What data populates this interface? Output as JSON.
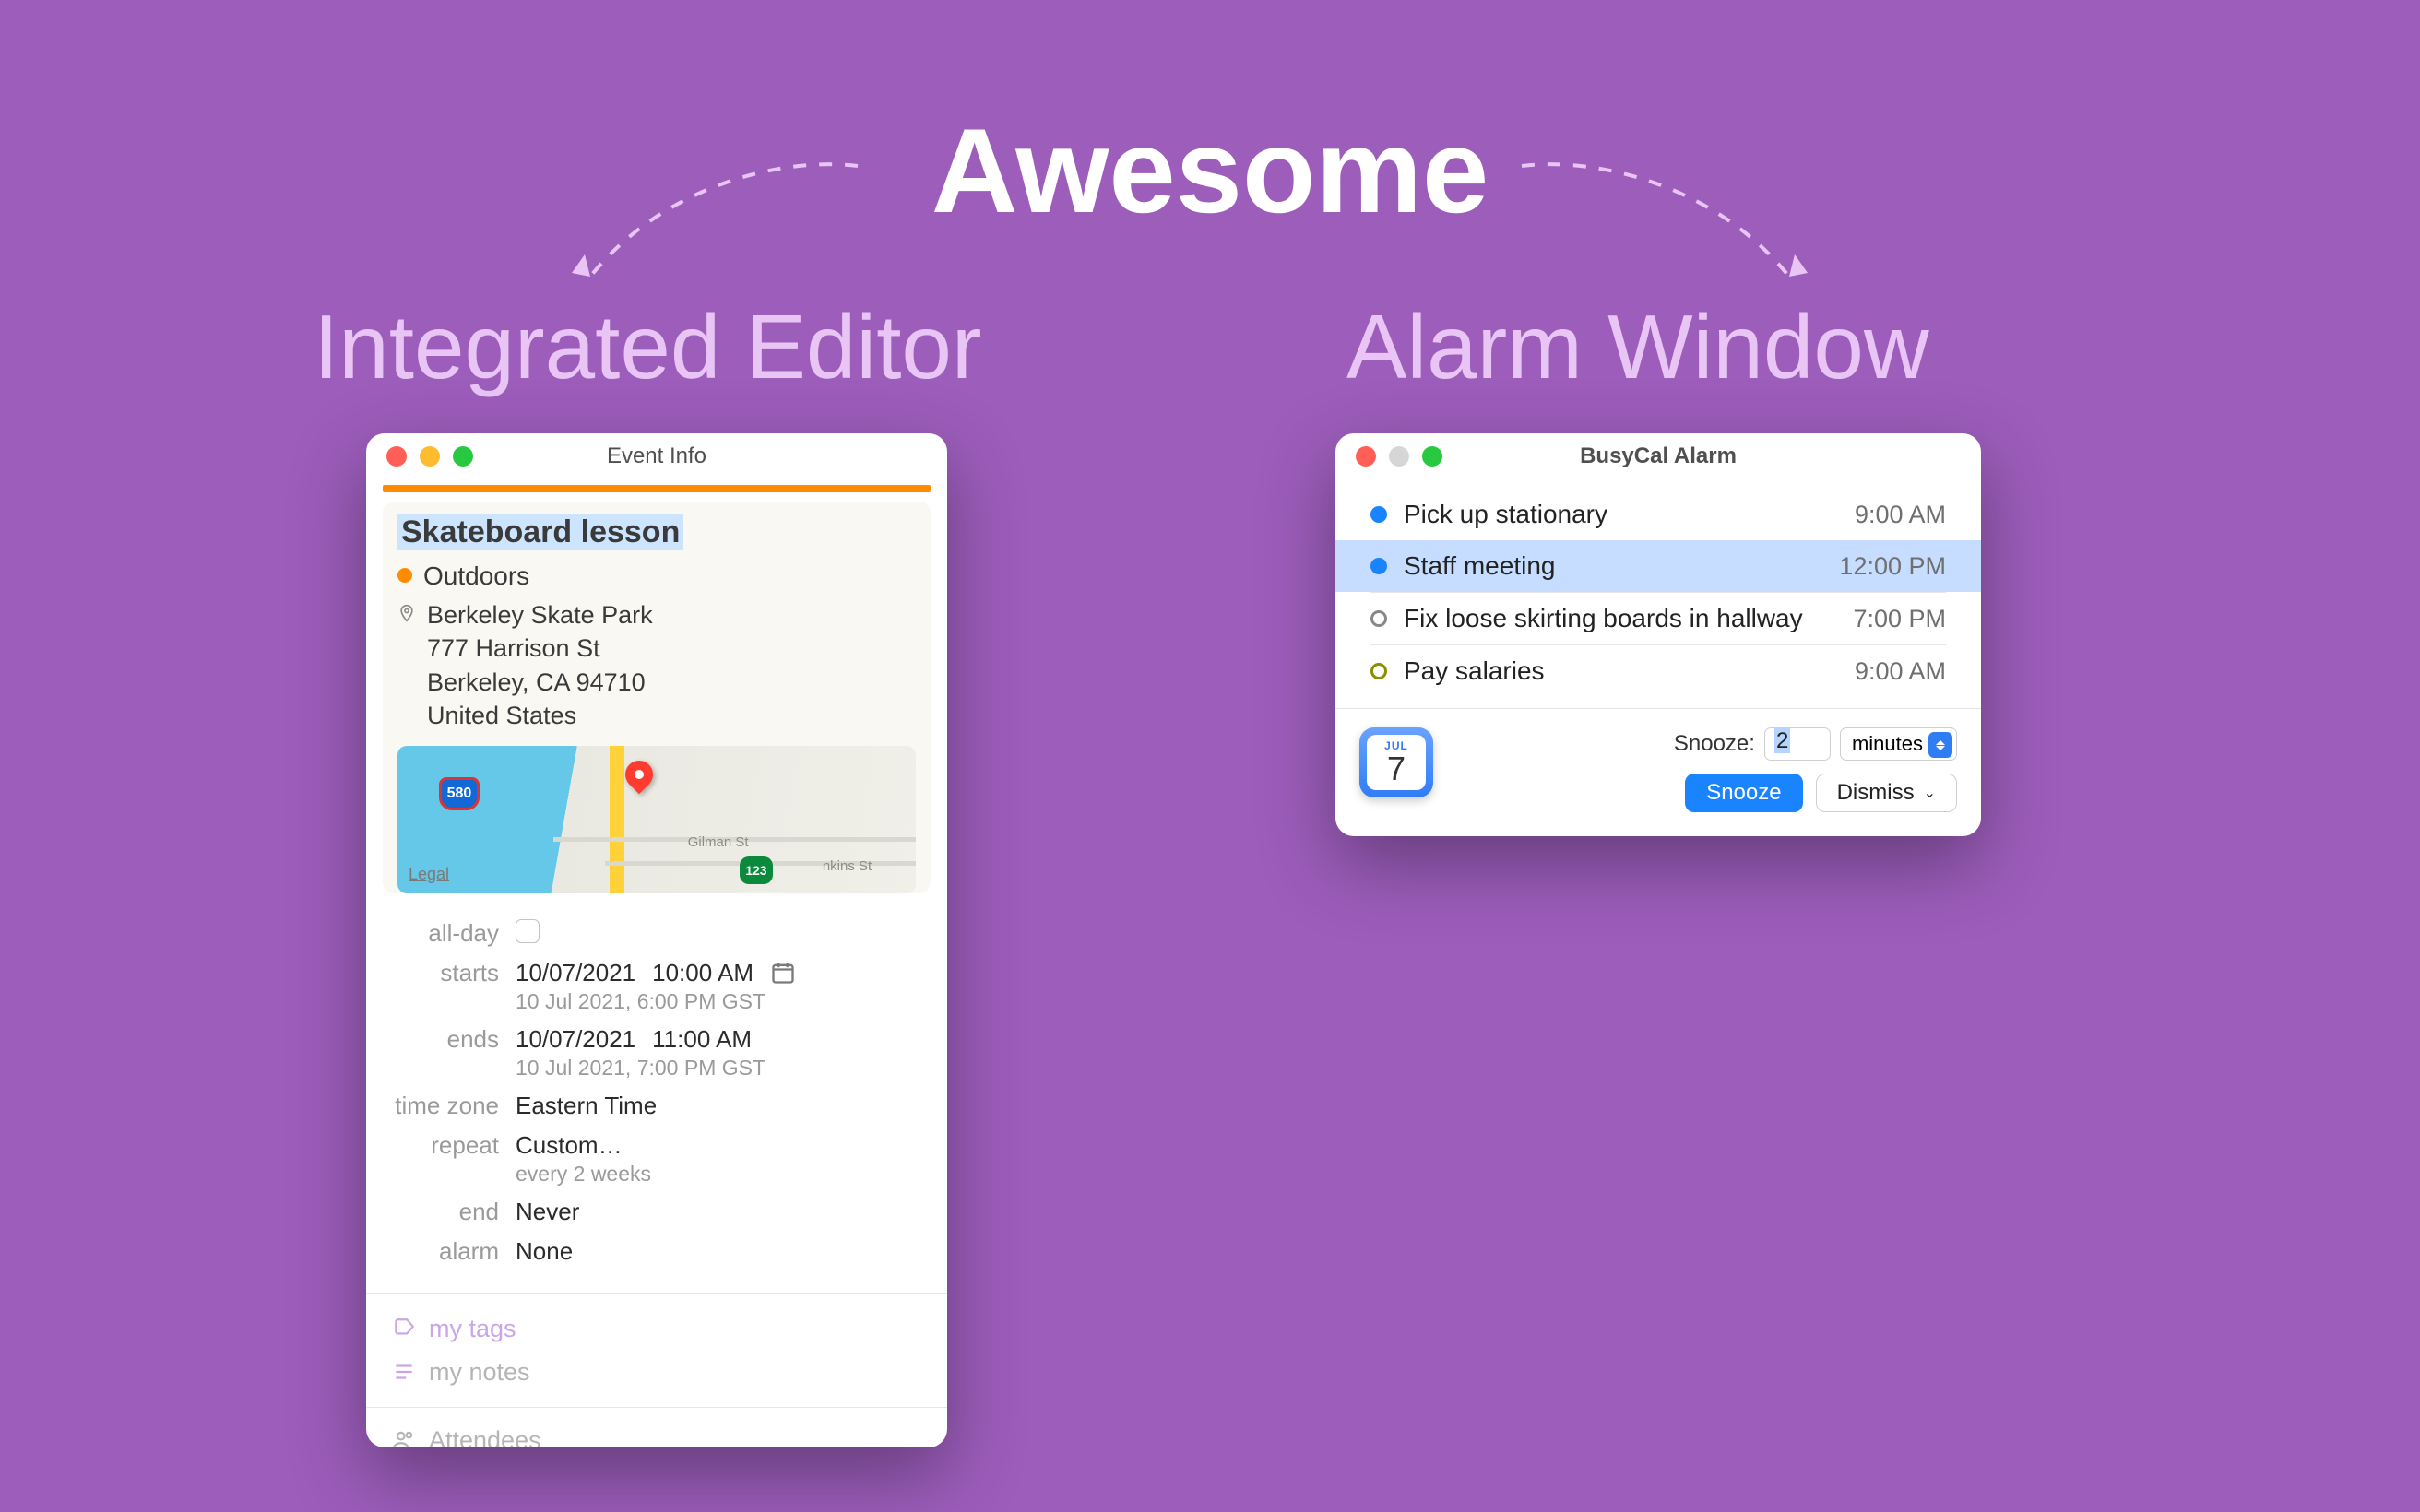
{
  "hero": {
    "title": "Awesome",
    "left": "Integrated Editor",
    "right": "Alarm Window"
  },
  "editor": {
    "window_title": "Event Info",
    "event_title": "Skateboard lesson",
    "calendar": "Outdoors",
    "location": {
      "name": "Berkeley Skate Park",
      "street": "777 Harrison St",
      "city_line": "Berkeley, CA  94710",
      "country": "United States"
    },
    "map": {
      "street1": "Gilman St",
      "street2": "nkins St",
      "shield1": "580",
      "shield2": "123",
      "legal": "Legal"
    },
    "fields": {
      "allday_label": "all-day",
      "starts_label": "starts",
      "starts_date": "10/07/2021",
      "starts_time": "10:00 AM",
      "starts_sub": "10 Jul 2021, 6:00 PM GST",
      "ends_label": "ends",
      "ends_date": "10/07/2021",
      "ends_time": "11:00 AM",
      "ends_sub": "10 Jul 2021, 7:00 PM GST",
      "tz_label": "time zone",
      "tz_value": "Eastern Time",
      "repeat_label": "repeat",
      "repeat_value": "Custom…",
      "repeat_sub": "every 2 weeks",
      "end_label": "end",
      "end_value": "Never",
      "alarm_label": "alarm",
      "alarm_value": "None"
    },
    "tags_placeholder": "my tags",
    "notes_placeholder": "my notes",
    "attendees_placeholder": "Attendees"
  },
  "alarm": {
    "window_title": "BusyCal Alarm",
    "items": [
      {
        "title": "Pick up stationary",
        "time": "9:00 AM",
        "kind": "dot-blue"
      },
      {
        "title": "Staff meeting",
        "time": "12:00 PM",
        "kind": "dot-blue",
        "selected": true
      },
      {
        "title": "Fix loose skirting boards in hallway",
        "time": "7:00 PM",
        "kind": "ring-gray"
      },
      {
        "title": "Pay salaries",
        "time": "9:00 AM",
        "kind": "ring-olive"
      }
    ],
    "date_month": "JUL",
    "date_day": "7",
    "snooze_label": "Snooze:",
    "snooze_value": "2",
    "snooze_unit": "minutes",
    "snooze_button": "Snooze",
    "dismiss_button": "Dismiss"
  }
}
